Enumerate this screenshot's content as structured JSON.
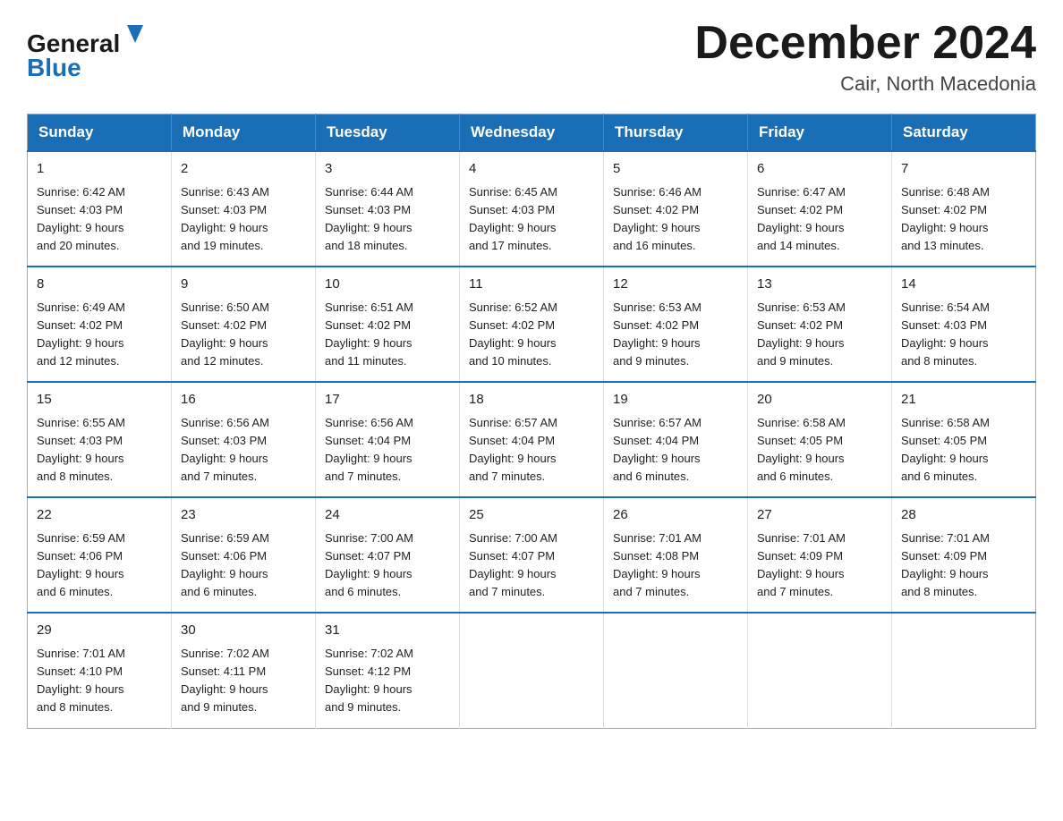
{
  "header": {
    "logo_line1": "General",
    "logo_line2": "Blue",
    "month_title": "December 2024",
    "location": "Cair, North Macedonia"
  },
  "days_of_week": [
    "Sunday",
    "Monday",
    "Tuesday",
    "Wednesday",
    "Thursday",
    "Friday",
    "Saturday"
  ],
  "weeks": [
    [
      {
        "day": "1",
        "sunrise": "6:42 AM",
        "sunset": "4:03 PM",
        "daylight": "9 hours and 20 minutes."
      },
      {
        "day": "2",
        "sunrise": "6:43 AM",
        "sunset": "4:03 PM",
        "daylight": "9 hours and 19 minutes."
      },
      {
        "day": "3",
        "sunrise": "6:44 AM",
        "sunset": "4:03 PM",
        "daylight": "9 hours and 18 minutes."
      },
      {
        "day": "4",
        "sunrise": "6:45 AM",
        "sunset": "4:03 PM",
        "daylight": "9 hours and 17 minutes."
      },
      {
        "day": "5",
        "sunrise": "6:46 AM",
        "sunset": "4:02 PM",
        "daylight": "9 hours and 16 minutes."
      },
      {
        "day": "6",
        "sunrise": "6:47 AM",
        "sunset": "4:02 PM",
        "daylight": "9 hours and 14 minutes."
      },
      {
        "day": "7",
        "sunrise": "6:48 AM",
        "sunset": "4:02 PM",
        "daylight": "9 hours and 13 minutes."
      }
    ],
    [
      {
        "day": "8",
        "sunrise": "6:49 AM",
        "sunset": "4:02 PM",
        "daylight": "9 hours and 12 minutes."
      },
      {
        "day": "9",
        "sunrise": "6:50 AM",
        "sunset": "4:02 PM",
        "daylight": "9 hours and 12 minutes."
      },
      {
        "day": "10",
        "sunrise": "6:51 AM",
        "sunset": "4:02 PM",
        "daylight": "9 hours and 11 minutes."
      },
      {
        "day": "11",
        "sunrise": "6:52 AM",
        "sunset": "4:02 PM",
        "daylight": "9 hours and 10 minutes."
      },
      {
        "day": "12",
        "sunrise": "6:53 AM",
        "sunset": "4:02 PM",
        "daylight": "9 hours and 9 minutes."
      },
      {
        "day": "13",
        "sunrise": "6:53 AM",
        "sunset": "4:02 PM",
        "daylight": "9 hours and 9 minutes."
      },
      {
        "day": "14",
        "sunrise": "6:54 AM",
        "sunset": "4:03 PM",
        "daylight": "9 hours and 8 minutes."
      }
    ],
    [
      {
        "day": "15",
        "sunrise": "6:55 AM",
        "sunset": "4:03 PM",
        "daylight": "9 hours and 8 minutes."
      },
      {
        "day": "16",
        "sunrise": "6:56 AM",
        "sunset": "4:03 PM",
        "daylight": "9 hours and 7 minutes."
      },
      {
        "day": "17",
        "sunrise": "6:56 AM",
        "sunset": "4:04 PM",
        "daylight": "9 hours and 7 minutes."
      },
      {
        "day": "18",
        "sunrise": "6:57 AM",
        "sunset": "4:04 PM",
        "daylight": "9 hours and 7 minutes."
      },
      {
        "day": "19",
        "sunrise": "6:57 AM",
        "sunset": "4:04 PM",
        "daylight": "9 hours and 6 minutes."
      },
      {
        "day": "20",
        "sunrise": "6:58 AM",
        "sunset": "4:05 PM",
        "daylight": "9 hours and 6 minutes."
      },
      {
        "day": "21",
        "sunrise": "6:58 AM",
        "sunset": "4:05 PM",
        "daylight": "9 hours and 6 minutes."
      }
    ],
    [
      {
        "day": "22",
        "sunrise": "6:59 AM",
        "sunset": "4:06 PM",
        "daylight": "9 hours and 6 minutes."
      },
      {
        "day": "23",
        "sunrise": "6:59 AM",
        "sunset": "4:06 PM",
        "daylight": "9 hours and 6 minutes."
      },
      {
        "day": "24",
        "sunrise": "7:00 AM",
        "sunset": "4:07 PM",
        "daylight": "9 hours and 6 minutes."
      },
      {
        "day": "25",
        "sunrise": "7:00 AM",
        "sunset": "4:07 PM",
        "daylight": "9 hours and 7 minutes."
      },
      {
        "day": "26",
        "sunrise": "7:01 AM",
        "sunset": "4:08 PM",
        "daylight": "9 hours and 7 minutes."
      },
      {
        "day": "27",
        "sunrise": "7:01 AM",
        "sunset": "4:09 PM",
        "daylight": "9 hours and 7 minutes."
      },
      {
        "day": "28",
        "sunrise": "7:01 AM",
        "sunset": "4:09 PM",
        "daylight": "9 hours and 8 minutes."
      }
    ],
    [
      {
        "day": "29",
        "sunrise": "7:01 AM",
        "sunset": "4:10 PM",
        "daylight": "9 hours and 8 minutes."
      },
      {
        "day": "30",
        "sunrise": "7:02 AM",
        "sunset": "4:11 PM",
        "daylight": "9 hours and 9 minutes."
      },
      {
        "day": "31",
        "sunrise": "7:02 AM",
        "sunset": "4:12 PM",
        "daylight": "9 hours and 9 minutes."
      },
      null,
      null,
      null,
      null
    ]
  ],
  "labels": {
    "sunrise": "Sunrise:",
    "sunset": "Sunset:",
    "daylight": "Daylight:"
  }
}
